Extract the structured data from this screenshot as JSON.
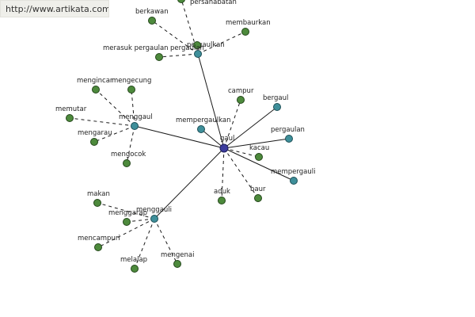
{
  "source": {
    "url_text": "http://www.artikata.com"
  },
  "colors": {
    "center": "#3c3c9e",
    "hub": "#3e8f9a",
    "leaf": "#4d8a3c",
    "edge": "#1a1a1a"
  },
  "graph": {
    "nodes": [
      {
        "id": "gaul",
        "label": "gaul",
        "kind": "center"
      },
      {
        "id": "pergaulkan",
        "label": "pergaulkan",
        "kind": "hub"
      },
      {
        "id": "menggaul",
        "label": "menggaul",
        "kind": "hub"
      },
      {
        "id": "menggauli",
        "label": "menggauli",
        "kind": "hub"
      },
      {
        "id": "mempergaulkan",
        "label": "mempergaulkan",
        "kind": "hub"
      },
      {
        "id": "bergaul",
        "label": "bergaul",
        "kind": "hub"
      },
      {
        "id": "pergaulan",
        "label": "pergaulan",
        "kind": "hub"
      },
      {
        "id": "mempergauli",
        "label": "mempergauli",
        "kind": "hub"
      },
      {
        "id": "persahabatan",
        "label": "persahabatan",
        "kind": "leaf"
      },
      {
        "id": "berkawan",
        "label": "berkawan",
        "kind": "leaf"
      },
      {
        "id": "membaurkan",
        "label": "membaurkan",
        "kind": "leaf"
      },
      {
        "id": "merasuk-pergaulan",
        "label": "merasuk pergaulan",
        "kind": "leaf"
      },
      {
        "id": "pergaulan-2",
        "label": "pergaulan",
        "kind": "leaf"
      },
      {
        "id": "campur",
        "label": "campur",
        "kind": "leaf"
      },
      {
        "id": "kacau",
        "label": "kacau",
        "kind": "leaf"
      },
      {
        "id": "aduk",
        "label": "aduk",
        "kind": "leaf"
      },
      {
        "id": "baur",
        "label": "baur",
        "kind": "leaf"
      },
      {
        "id": "mengincar",
        "label": "mengincar",
        "kind": "leaf"
      },
      {
        "id": "mengecung",
        "label": "mengecung",
        "kind": "leaf"
      },
      {
        "id": "memutar",
        "label": "memutar",
        "kind": "leaf"
      },
      {
        "id": "mengarau",
        "label": "mengarau",
        "kind": "leaf"
      },
      {
        "id": "mengocok",
        "label": "mengocok",
        "kind": "leaf"
      },
      {
        "id": "makan",
        "label": "makan",
        "kind": "leaf"
      },
      {
        "id": "menggarap",
        "label": "menggarap",
        "kind": "leaf"
      },
      {
        "id": "mencampuri",
        "label": "mencampuri",
        "kind": "leaf"
      },
      {
        "id": "melalap",
        "label": "melalap",
        "kind": "leaf"
      },
      {
        "id": "mengenai",
        "label": "mengenai",
        "kind": "leaf"
      }
    ],
    "edges": [
      {
        "from": "gaul",
        "to": "pergaulkan",
        "style": "solid"
      },
      {
        "from": "gaul",
        "to": "menggaul",
        "style": "solid"
      },
      {
        "from": "gaul",
        "to": "menggauli",
        "style": "solid"
      },
      {
        "from": "gaul",
        "to": "mempergaulkan",
        "style": "solid"
      },
      {
        "from": "gaul",
        "to": "bergaul",
        "style": "solid"
      },
      {
        "from": "gaul",
        "to": "pergaulan",
        "style": "solid"
      },
      {
        "from": "gaul",
        "to": "mempergauli",
        "style": "solid"
      },
      {
        "from": "gaul",
        "to": "campur",
        "style": "dashed"
      },
      {
        "from": "gaul",
        "to": "kacau",
        "style": "dashed"
      },
      {
        "from": "gaul",
        "to": "aduk",
        "style": "dashed"
      },
      {
        "from": "gaul",
        "to": "baur",
        "style": "dashed"
      },
      {
        "from": "pergaulkan",
        "to": "persahabatan",
        "style": "dashed"
      },
      {
        "from": "pergaulkan",
        "to": "berkawan",
        "style": "dashed"
      },
      {
        "from": "pergaulkan",
        "to": "membaurkan",
        "style": "dashed"
      },
      {
        "from": "pergaulkan",
        "to": "merasuk-pergaulan",
        "style": "dashed"
      },
      {
        "from": "pergaulkan",
        "to": "pergaulan-2",
        "style": "dashed"
      },
      {
        "from": "menggaul",
        "to": "mengincar",
        "style": "dashed"
      },
      {
        "from": "menggaul",
        "to": "mengecung",
        "style": "dashed"
      },
      {
        "from": "menggaul",
        "to": "memutar",
        "style": "dashed"
      },
      {
        "from": "menggaul",
        "to": "mengarau",
        "style": "dashed"
      },
      {
        "from": "menggaul",
        "to": "mengocok",
        "style": "dashed"
      },
      {
        "from": "menggauli",
        "to": "makan",
        "style": "dashed"
      },
      {
        "from": "menggauli",
        "to": "menggarap",
        "style": "dashed"
      },
      {
        "from": "menggauli",
        "to": "mencampuri",
        "style": "dashed"
      },
      {
        "from": "menggauli",
        "to": "melalap",
        "style": "dashed"
      },
      {
        "from": "menggauli",
        "to": "mengenai",
        "style": "dashed"
      }
    ]
  }
}
